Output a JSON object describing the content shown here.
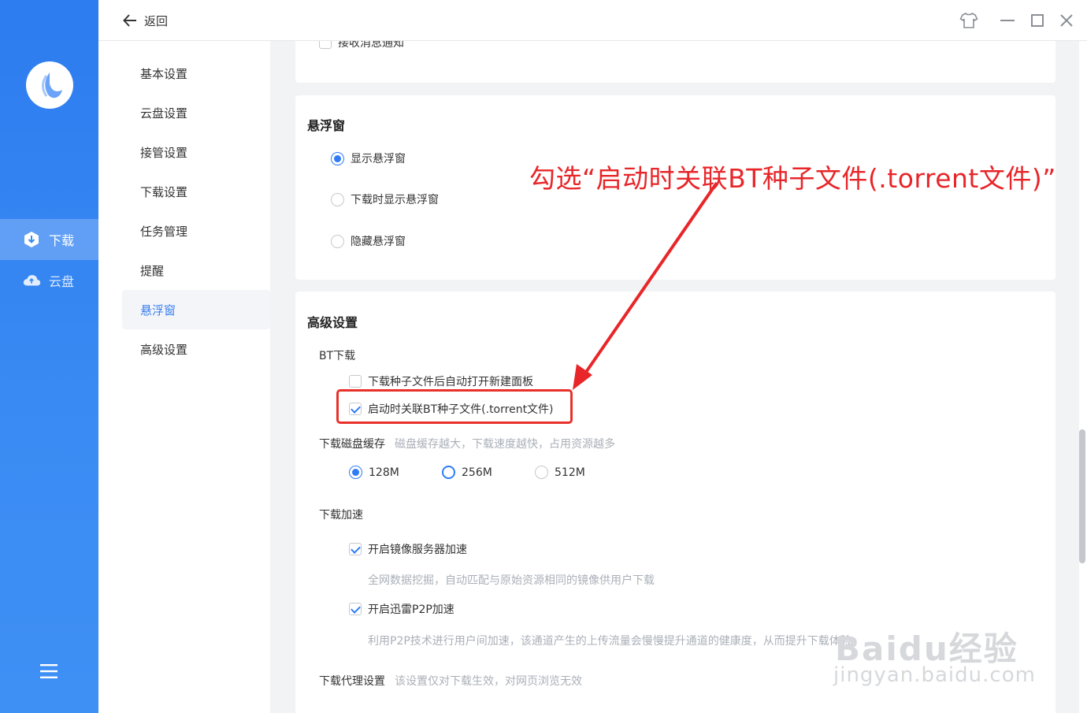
{
  "rail": {
    "items": [
      {
        "label": "下载",
        "icon": "download-shield-icon",
        "active": true
      },
      {
        "label": "云盘",
        "icon": "cloud-icon",
        "active": false
      }
    ],
    "menu_icon": "hamburger-icon"
  },
  "topbar": {
    "back_label": "返回",
    "buttons": [
      "skin-icon",
      "minimize-icon",
      "maximize-icon",
      "close-icon"
    ]
  },
  "subnav": {
    "items": [
      "基本设置",
      "云盘设置",
      "接管设置",
      "下载设置",
      "任务管理",
      "提醒",
      "悬浮窗",
      "高级设置"
    ],
    "active_index": 6
  },
  "top_card": {
    "partial_option": "接收消息通知"
  },
  "float_card": {
    "title": "悬浮窗",
    "options": [
      {
        "label": "显示悬浮窗",
        "selected": true
      },
      {
        "label": "下载时显示悬浮窗",
        "selected": false
      },
      {
        "label": "隐藏悬浮窗",
        "selected": false
      }
    ]
  },
  "advanced_card": {
    "title": "高级设置",
    "bt": {
      "label": "BT下载",
      "options": [
        {
          "label": "下载种子文件后自动打开新建面板",
          "checked": false
        },
        {
          "label": "启动时关联BT种子文件(.torrent文件)",
          "checked": true
        }
      ]
    },
    "cache": {
      "label": "下载磁盘缓存",
      "hint": "磁盘缓存越大，下载速度越快，占用资源越多",
      "options": [
        {
          "label": "128M",
          "selected": true
        },
        {
          "label": "256M",
          "selected": false
        },
        {
          "label": "512M",
          "selected": false
        }
      ]
    },
    "accel": {
      "label": "下载加速",
      "options": [
        {
          "label": "开启镜像服务器加速",
          "checked": true,
          "desc": "全网数据挖掘，自动匹配与原始资源相同的镜像供用户下载"
        },
        {
          "label": "开启迅雷P2P加速",
          "checked": true,
          "desc": "利用P2P技术进行用户间加速，该通道产生的上传流量会慢慢提升通道的健康度，从而提升下载体验"
        }
      ]
    },
    "proxy": {
      "label": "下载代理设置",
      "hint": "该设置仅对下载生效，对网页浏览无效"
    }
  },
  "annotation": {
    "text": "勾选“启动时关联BT种子文件(.torrent文件)”",
    "color": "#e8262a"
  },
  "watermark": {
    "line1": "Baidu经验",
    "line2": "jingyan.baidu.com"
  },
  "colors": {
    "rail_blue": "#2d7cf0",
    "accent": "#2f7cf6",
    "annotation_red": "#e8312a"
  }
}
